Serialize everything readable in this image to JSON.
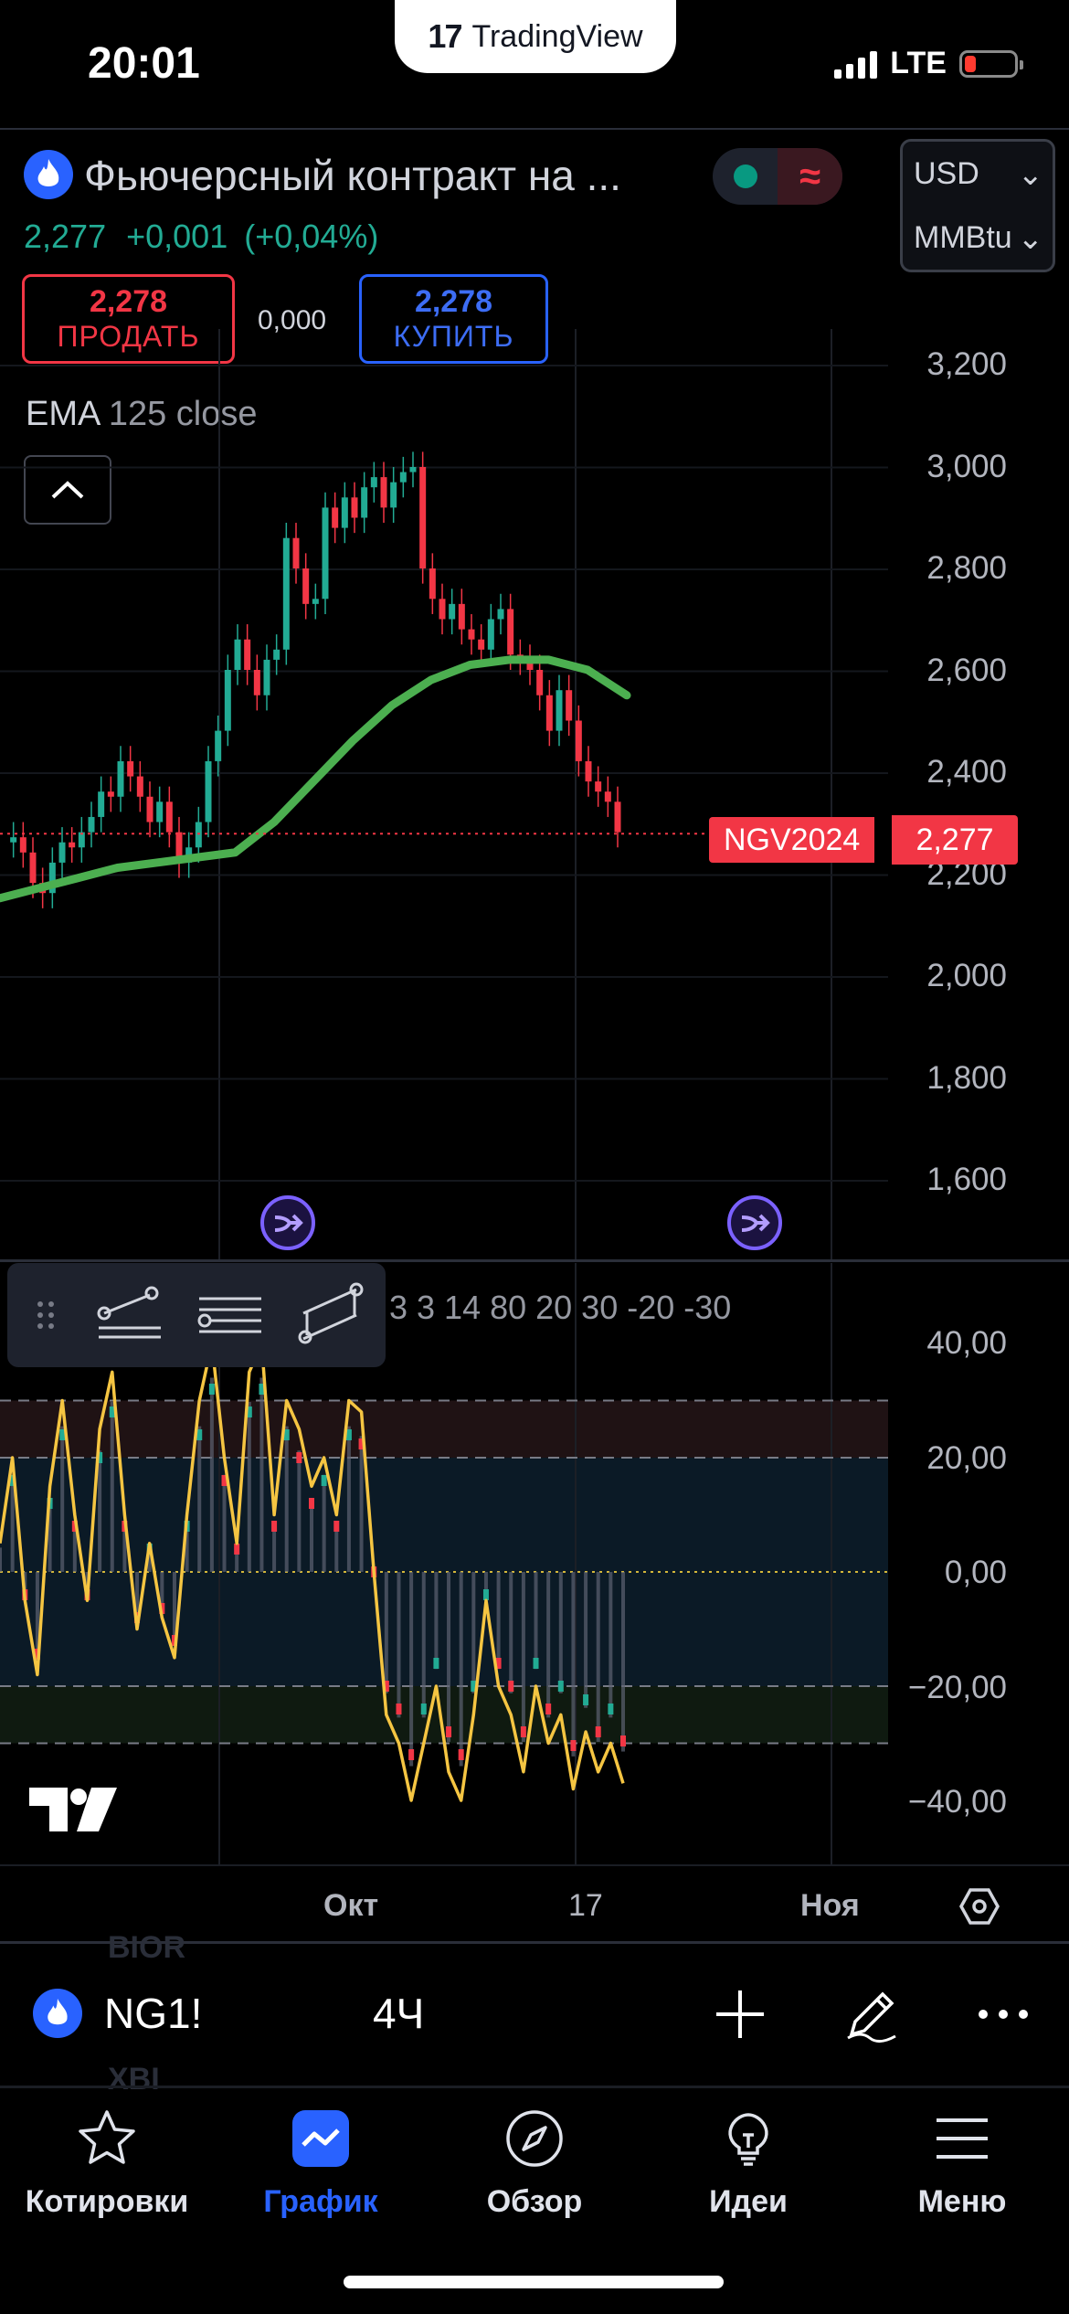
{
  "status_bar": {
    "time": "20:01",
    "network": "LTE"
  },
  "app_pill": {
    "brand": "TradingView",
    "logo_glyph": "17"
  },
  "header": {
    "symbol_name": "Фьючерсный контракт на ...",
    "last_price": "2,277",
    "change": "+0,001",
    "change_pct": "(+0,04%)",
    "currency": "USD",
    "unit": "MMBtu",
    "sell_price": "2,278",
    "sell_label": "ПРОДАТЬ",
    "spread": "0,000",
    "buy_price": "2,278",
    "buy_label": "КУПИТЬ",
    "session_glyph": "≈"
  },
  "indicator": {
    "name": "EMA",
    "params": "125 close"
  },
  "price_tag": {
    "symbol": "NGV2024",
    "price": "2,277"
  },
  "oscillator": {
    "values": "3 3 14 80 20 30 -20 -30"
  },
  "colors": {
    "up": "#22ab94",
    "down": "#f23645",
    "ema": "#4caf50",
    "accent": "#2962ff",
    "osc_line": "#f5c542"
  },
  "chart_data": [
    {
      "type": "candlestick",
      "indicator": "EMA 125 close",
      "y_ticks": [
        "3,200",
        "3,000",
        "2,800",
        "2,600",
        "2,400",
        "2,200",
        "2,000",
        "1,800",
        "1,600"
      ],
      "ylim": [
        1.5,
        3.3
      ],
      "x_ticks": [
        "Окт",
        "17",
        "Ноя"
      ],
      "last_price": 2.277,
      "close_path": [
        2.26,
        2.27,
        2.24,
        2.18,
        2.16,
        2.22,
        2.26,
        2.25,
        2.28,
        2.31,
        2.36,
        2.35,
        2.42,
        2.39,
        2.35,
        2.3,
        2.34,
        2.28,
        2.22,
        2.25,
        2.3,
        2.42,
        2.48,
        2.6,
        2.66,
        2.6,
        2.55,
        2.62,
        2.64,
        2.86,
        2.8,
        2.73,
        2.74,
        2.92,
        2.88,
        2.94,
        2.9,
        2.96,
        2.98,
        2.92,
        2.97,
        2.99,
        3.0,
        2.8,
        2.74,
        2.7,
        2.73,
        2.68,
        2.66,
        2.64,
        2.7,
        2.72,
        2.63,
        2.62,
        2.6,
        2.55,
        2.48,
        2.56,
        2.5,
        2.42,
        2.38,
        2.36,
        2.34,
        2.28
      ],
      "ema_path": [
        2.15,
        2.17,
        2.19,
        2.21,
        2.22,
        2.23,
        2.24,
        2.3,
        2.38,
        2.46,
        2.53,
        2.58,
        2.61,
        2.62,
        2.62,
        2.6,
        2.55
      ]
    },
    {
      "type": "oscillator",
      "y_ticks": [
        "40,00",
        "20,00",
        "0,00",
        "−20,00",
        "−40,00"
      ],
      "ylim": [
        -45,
        45
      ],
      "levels": [
        30,
        20,
        0,
        -20,
        -30
      ],
      "series_path": [
        5,
        20,
        -5,
        -18,
        15,
        30,
        10,
        -5,
        25,
        35,
        10,
        -10,
        5,
        -8,
        -15,
        10,
        30,
        40,
        20,
        5,
        35,
        40,
        10,
        30,
        25,
        15,
        20,
        10,
        30,
        28,
        0,
        -25,
        -30,
        -40,
        -30,
        -20,
        -35,
        -40,
        -25,
        -5,
        -20,
        -25,
        -35,
        -20,
        -30,
        -25,
        -38,
        -28,
        -35,
        -30,
        -37
      ]
    }
  ],
  "symbol_bar": {
    "symbol": "NG1!",
    "interval": "4Ч",
    "ghost_top": "BIOR",
    "ghost_bottom": "XBI"
  },
  "tabs": [
    {
      "label": "Котировки",
      "icon": "star-icon"
    },
    {
      "label": "График",
      "icon": "chart-icon",
      "active": true
    },
    {
      "label": "Обзор",
      "icon": "compass-icon"
    },
    {
      "label": "Идеи",
      "icon": "lightbulb-icon"
    },
    {
      "label": "Меню",
      "icon": "menu-icon"
    }
  ]
}
